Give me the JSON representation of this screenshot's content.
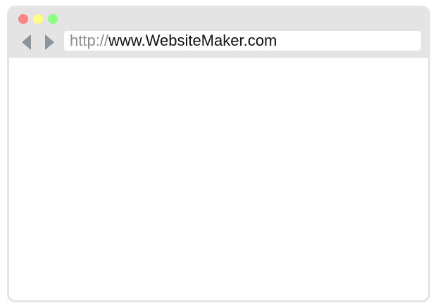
{
  "window": {
    "controls": {
      "close_color": "#ff8585",
      "minimize_color": "#ffff80",
      "maximize_color": "#8cff7d"
    },
    "chrome_color": "#e4e4e4",
    "nav": {
      "back_icon": "arrow-left-icon",
      "forward_icon": "arrow-right-icon",
      "arrow_color": "#8a949b"
    },
    "address": {
      "scheme": "http://",
      "host": "www.WebsiteMaker.com"
    }
  }
}
